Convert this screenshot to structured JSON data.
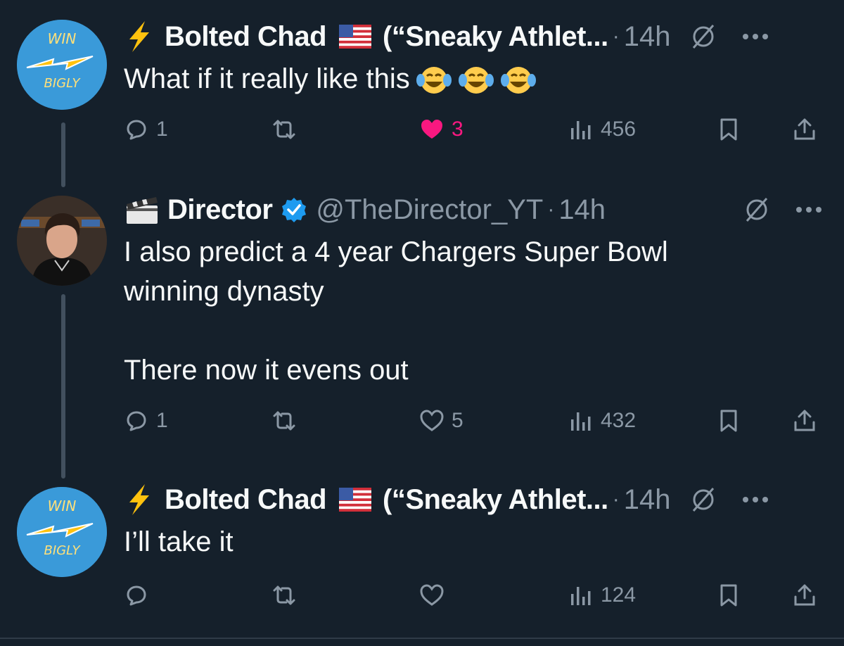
{
  "tweets": [
    {
      "author_name": "Bolted Chad",
      "author_nick": "(“Sneaky Athlet...",
      "handle": "",
      "time": "14h",
      "avatar_text_top": "WIN",
      "avatar_text_bottom": "BIGLY",
      "text": "What if it really like this",
      "emoji": [
        "face-with-tears-of-joy",
        "face-with-tears-of-joy",
        "face-with-tears-of-joy"
      ],
      "actions": {
        "replies": "1",
        "reposts": "",
        "likes": "3",
        "liked": true,
        "views": "456"
      }
    },
    {
      "author_name": "Director",
      "handle": "@TheDirector_YT",
      "time": "14h",
      "verified": true,
      "text_lines": [
        "I also predict a 4 year Chargers Super Bowl",
        "winning dynasty",
        "",
        "There now it evens out"
      ],
      "actions": {
        "replies": "1",
        "reposts": "",
        "likes": "5",
        "liked": false,
        "views": "432"
      }
    },
    {
      "author_name": "Bolted Chad",
      "author_nick": "(“Sneaky Athlet...",
      "handle": "",
      "time": "14h",
      "avatar_text_top": "WIN",
      "avatar_text_bottom": "BIGLY",
      "text": "I’ll take it",
      "actions": {
        "replies": "",
        "reposts": "",
        "likes": "",
        "liked": false,
        "views": "124"
      }
    }
  ],
  "separator_dot": "·",
  "colors": {
    "background": "#15202b",
    "text_primary": "#f7f9f9",
    "text_secondary": "#8b98a5",
    "like_pink": "#f91880",
    "verified_blue": "#1d9bf0",
    "avatar_blue": "#3a9ad9",
    "bolt_yellow": "#ffc20e"
  },
  "icons": {
    "reply": "reply-icon",
    "repost": "repost-icon",
    "like": "heart-icon",
    "views": "views-icon",
    "bookmark": "bookmark-icon",
    "share": "share-icon",
    "grok": "grok-icon",
    "more": "more-icon"
  }
}
